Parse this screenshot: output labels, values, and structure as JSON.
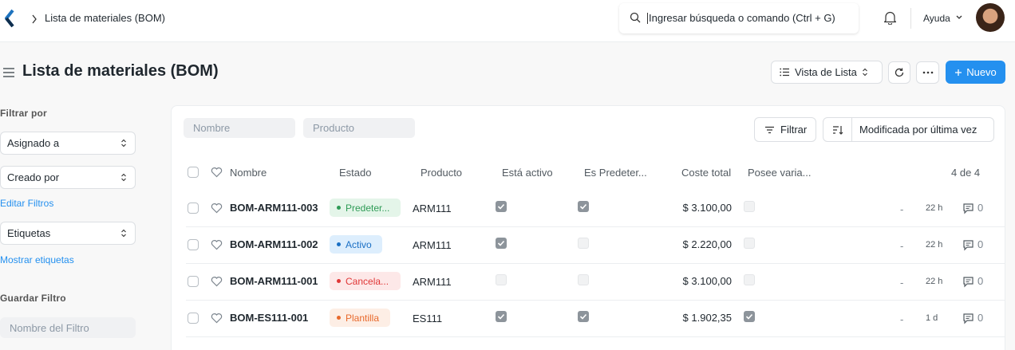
{
  "navbar": {
    "breadcrumb": "Lista de materiales (BOM)",
    "search_placeholder": "Ingresar búsqueda o comando (Ctrl + G)",
    "help_label": "Ayuda"
  },
  "page": {
    "title": "Lista de materiales (BOM)",
    "view_label": "Vista de Lista",
    "new_label": "Nuevo"
  },
  "sidebar": {
    "filter_by_label": "Filtrar por",
    "assigned_to": "Asignado a",
    "created_by": "Creado por",
    "edit_filters": "Editar Filtros",
    "tags": "Etiquetas",
    "show_tags": "Mostrar etiquetas",
    "save_filter_label": "Guardar Filtro",
    "filter_name_placeholder": "Nombre del Filtro"
  },
  "filters": {
    "name_placeholder": "Nombre",
    "product_placeholder": "Producto",
    "filter_button": "Filtrar",
    "sort_label": "Modificada por última vez"
  },
  "table": {
    "headers": {
      "name": "Nombre",
      "status": "Estado",
      "product": "Producto",
      "is_active": "Está activo",
      "is_default": "Es Predeter...",
      "total_cost": "Coste total",
      "has_variants": "Posee varia..."
    },
    "count": "4 de 4",
    "rows": [
      {
        "name": "BOM-ARM111-003",
        "status": "Predeter...",
        "status_color": "#2e9b56",
        "status_bg": "#e4f5e9",
        "product": "ARM111",
        "is_active": true,
        "is_default": true,
        "total_cost": "$ 3.100,00",
        "has_variants": false,
        "dash": "-",
        "time": "22 h",
        "comments": "0"
      },
      {
        "name": "BOM-ARM111-002",
        "status": "Activo",
        "status_color": "#1a6fc4",
        "status_bg": "#ddeefd",
        "product": "ARM111",
        "is_active": true,
        "is_default": false,
        "total_cost": "$ 2.220,00",
        "has_variants": false,
        "dash": "-",
        "time": "22 h",
        "comments": "0"
      },
      {
        "name": "BOM-ARM111-001",
        "status": "Cancela...",
        "status_color": "#e03636",
        "status_bg": "#fde8e8",
        "product": "ARM111",
        "is_active": false,
        "is_default": false,
        "total_cost": "$ 3.100,00",
        "has_variants": false,
        "dash": "-",
        "time": "22 h",
        "comments": "0"
      },
      {
        "name": "BOM-ES111-001",
        "status": "Plantilla",
        "status_color": "#e8692c",
        "status_bg": "#fdeee5",
        "product": "ES111",
        "is_active": true,
        "is_default": true,
        "total_cost": "$ 1.902,35",
        "has_variants": true,
        "dash": "-",
        "time": "1 d",
        "comments": "0"
      }
    ]
  },
  "colors": {
    "accent": "#2490ef"
  }
}
